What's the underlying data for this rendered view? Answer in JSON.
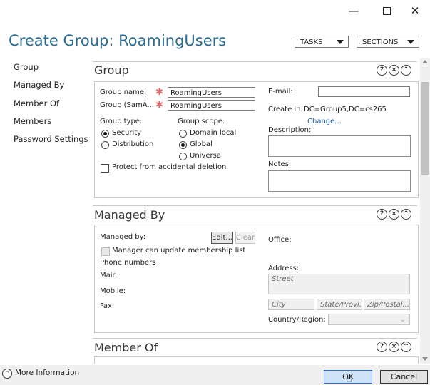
{
  "window": {
    "title_fragment": "... ... ..... ...... ..."
  },
  "header": {
    "title": "Create Group: RoamingUsers",
    "tasks_label": "TASKS",
    "sections_label": "SECTIONS"
  },
  "nav": {
    "items": [
      {
        "label": "Group"
      },
      {
        "label": "Managed By"
      },
      {
        "label": "Member Of"
      },
      {
        "label": "Members"
      },
      {
        "label": "Password Settings"
      }
    ]
  },
  "group_section": {
    "title": "Group",
    "group_name_label": "Group name:",
    "group_name_value": "RoamingUsers",
    "sam_label": "Group (SamA...",
    "sam_value": "RoamingUsers",
    "group_type_label": "Group type:",
    "group_type_options": [
      "Security",
      "Distribution"
    ],
    "group_type_selected": "Security",
    "group_scope_label": "Group scope:",
    "group_scope_options": [
      "Domain local",
      "Global",
      "Universal"
    ],
    "group_scope_selected": "Global",
    "protect_label": "Protect from accidental deletion",
    "email_label": "E-mail:",
    "email_value": "",
    "create_in_label": "Create in:",
    "create_in_value": "DC=Group5,DC=cs265",
    "change_link": "Change...",
    "description_label": "Description:",
    "notes_label": "Notes:"
  },
  "managed_by_section": {
    "title": "Managed By",
    "managed_by_label": "Managed by:",
    "edit_button": "Edit...",
    "clear_button": "Clear",
    "manager_update_label": "Manager can update membership list",
    "phone_numbers_label": "Phone numbers",
    "main_label": "Main:",
    "mobile_label": "Mobile:",
    "fax_label": "Fax:",
    "office_label": "Office:",
    "address_label": "Address:",
    "street_placeholder": "Street",
    "city_placeholder": "City",
    "state_placeholder": "State/Provi...",
    "zip_placeholder": "Zip/Postal...",
    "country_label": "Country/Region:"
  },
  "member_of_section": {
    "title": "Member Of"
  },
  "section_controls": {
    "help": "?",
    "close": "×",
    "collapse": "^"
  },
  "footer": {
    "more_info": "More Information",
    "ok": "OK",
    "cancel": "Cancel"
  }
}
